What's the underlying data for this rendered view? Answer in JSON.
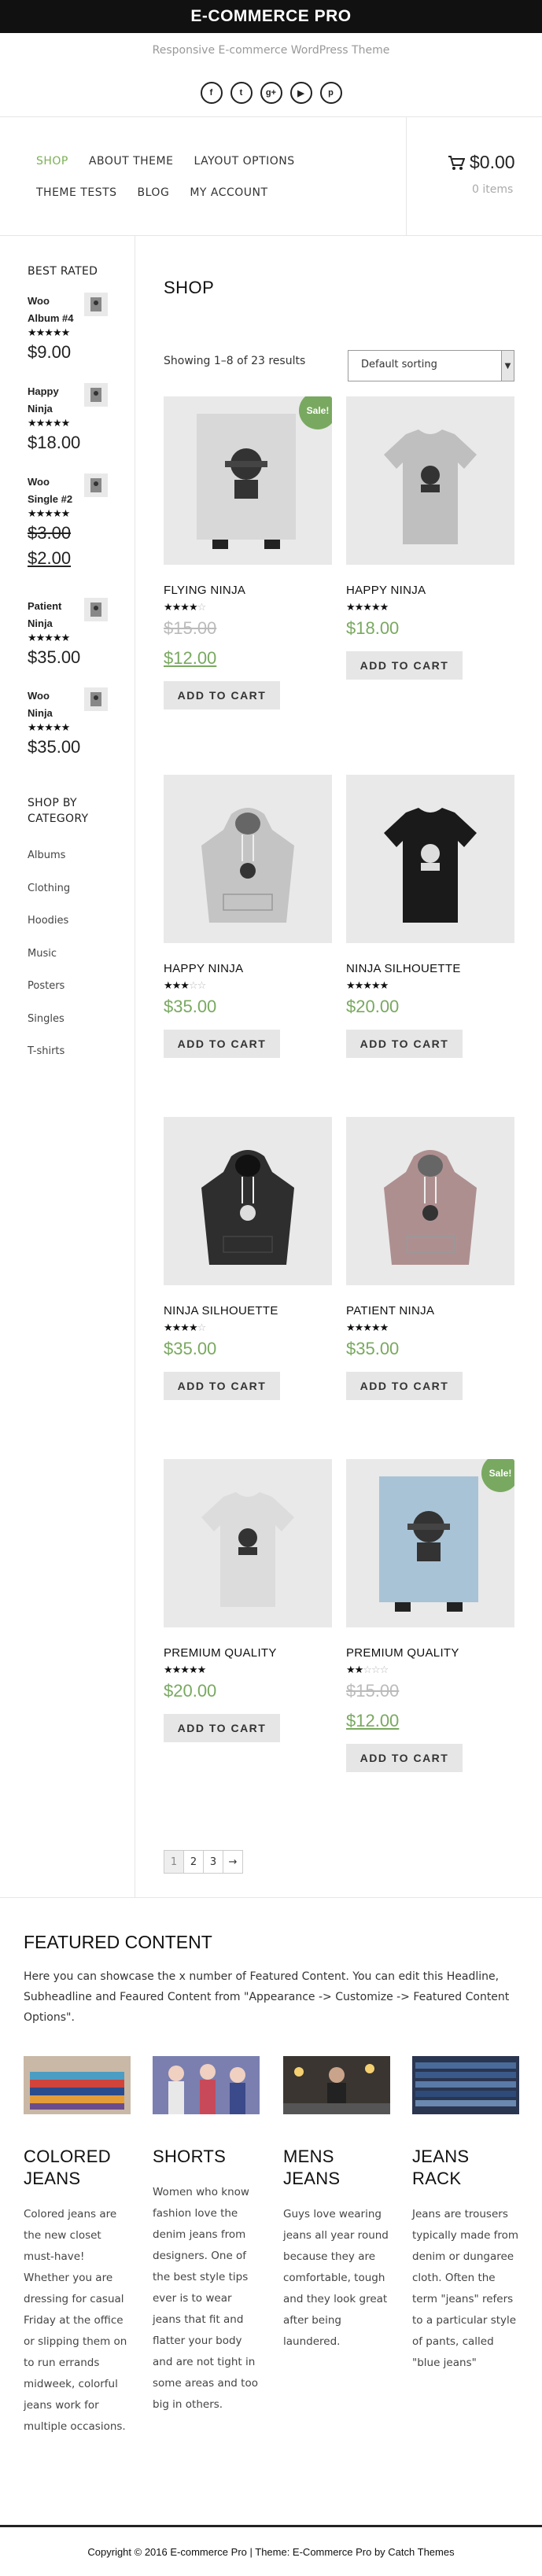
{
  "site": {
    "title": "E-COMMERCE PRO",
    "tagline": "Responsive E-commerce WordPress Theme",
    "social_icons": [
      "facebook-icon",
      "twitter-icon",
      "googleplus-icon",
      "youtube-icon",
      "pinterest-icon"
    ],
    "social_glyphs": [
      "f",
      "t",
      "g+",
      "▶",
      "p"
    ]
  },
  "nav": {
    "row1": [
      "SHOP",
      "ABOUT THEME",
      "LAYOUT OPTIONS"
    ],
    "row2": [
      "THEME TESTS",
      "BLOG",
      "MY ACCOUNT"
    ],
    "active": "SHOP"
  },
  "cart": {
    "total": "$0.00",
    "items": "0 items"
  },
  "sidebar": {
    "best_rated_title": "BEST RATED",
    "best_rated": [
      {
        "name_l1": "Woo",
        "name_l2": "Album #4",
        "stars": "★★★★★",
        "price": "$9.00"
      },
      {
        "name_l1": "Happy",
        "name_l2": "Ninja",
        "stars": "★★★★★",
        "price": "$18.00"
      },
      {
        "name_l1": "Woo",
        "name_l2": "Single #2",
        "stars": "★★★★★",
        "old_price": "$3.00",
        "price": "$2.00"
      },
      {
        "name_l1": "Patient",
        "name_l2": "Ninja",
        "stars": "★★★★★",
        "price": "$35.00"
      },
      {
        "name_l1": "Woo",
        "name_l2": "Ninja",
        "stars": "★★★★★",
        "price": "$35.00"
      }
    ],
    "category_title_l1": "SHOP BY",
    "category_title_l2": "CATEGORY",
    "categories": [
      "Albums",
      "Clothing",
      "Hoodies",
      "Music",
      "Posters",
      "Singles",
      "T-shirts"
    ]
  },
  "shop": {
    "title": "SHOP",
    "result_count": "Showing 1–8 of 23 results",
    "ordering": "Default sorting",
    "add_to_cart": "ADD TO CART",
    "sale_badge": "Sale!",
    "products": [
      {
        "name": "FLYING NINJA",
        "rating": 4,
        "old_price": "$15.00",
        "price": "$12.00",
        "sale": true,
        "kind": "poster",
        "color": "#d8d8d8"
      },
      {
        "name": "HAPPY NINJA",
        "rating": 5,
        "price": "$18.00",
        "sale": false,
        "kind": "tshirt",
        "color": "#bfbfbf"
      },
      {
        "name": "HAPPY NINJA",
        "rating": 3,
        "price": "$35.00",
        "sale": false,
        "kind": "hoodie",
        "color": "#c4c4c4"
      },
      {
        "name": "NINJA SILHOUETTE",
        "rating": 5,
        "price": "$20.00",
        "sale": false,
        "kind": "tshirt",
        "color": "#1a1a1a"
      },
      {
        "name": "NINJA SILHOUETTE",
        "rating": 4,
        "price": "$35.00",
        "sale": false,
        "kind": "hoodie",
        "color": "#2e2e2e"
      },
      {
        "name": "PATIENT NINJA",
        "rating": 5,
        "price": "$35.00",
        "sale": false,
        "kind": "hoodie",
        "color": "#ae8f90"
      },
      {
        "name": "PREMIUM QUALITY",
        "rating": 5,
        "price": "$20.00",
        "sale": false,
        "kind": "tshirt",
        "color": "#dcdcdc"
      },
      {
        "name": "PREMIUM QUALITY",
        "rating": 2,
        "old_price": "$15.00",
        "price": "$12.00",
        "sale": true,
        "kind": "poster",
        "color": "#a9c3d6"
      }
    ],
    "pagination": [
      "1",
      "2",
      "3",
      "→"
    ]
  },
  "featured": {
    "title": "FEATURED CONTENT",
    "description": "Here you can showcase the x number of Featured Content. You can edit this Headline, Subheadline and Feaured Content from \"Appearance -> Customize -> Featured Content Options\".",
    "items": [
      {
        "title_l1": "COLORED",
        "title_l2": "JEANS",
        "text": "Colored jeans are the new closet must-have! Whether you are dressing for casual Friday at the office or slipping them on to run errands midweek, colorful jeans work for multiple occasions."
      },
      {
        "title_l1": "SHORTS",
        "title_l2": "",
        "text": "Women who know fashion love the denim jeans from designers. One of the best style tips ever is to wear jeans that fit and flatter your body and are not tight in some areas and too big in others."
      },
      {
        "title_l1": "MENS",
        "title_l2": "JEANS",
        "text": "Guys love wearing jeans all year round because they are comfortable, tough and they look great after being laundered."
      },
      {
        "title_l1": "JEANS",
        "title_l2": "RACK",
        "text": "Jeans are trousers typically made from denim or dungaree cloth. Often the term \"jeans\" refers to a particular style of pants, called \"blue jeans\""
      }
    ]
  },
  "footer": {
    "text": "Copyright © 2016 E-commerce Pro | Theme: E-Commerce Pro by Catch Themes"
  }
}
